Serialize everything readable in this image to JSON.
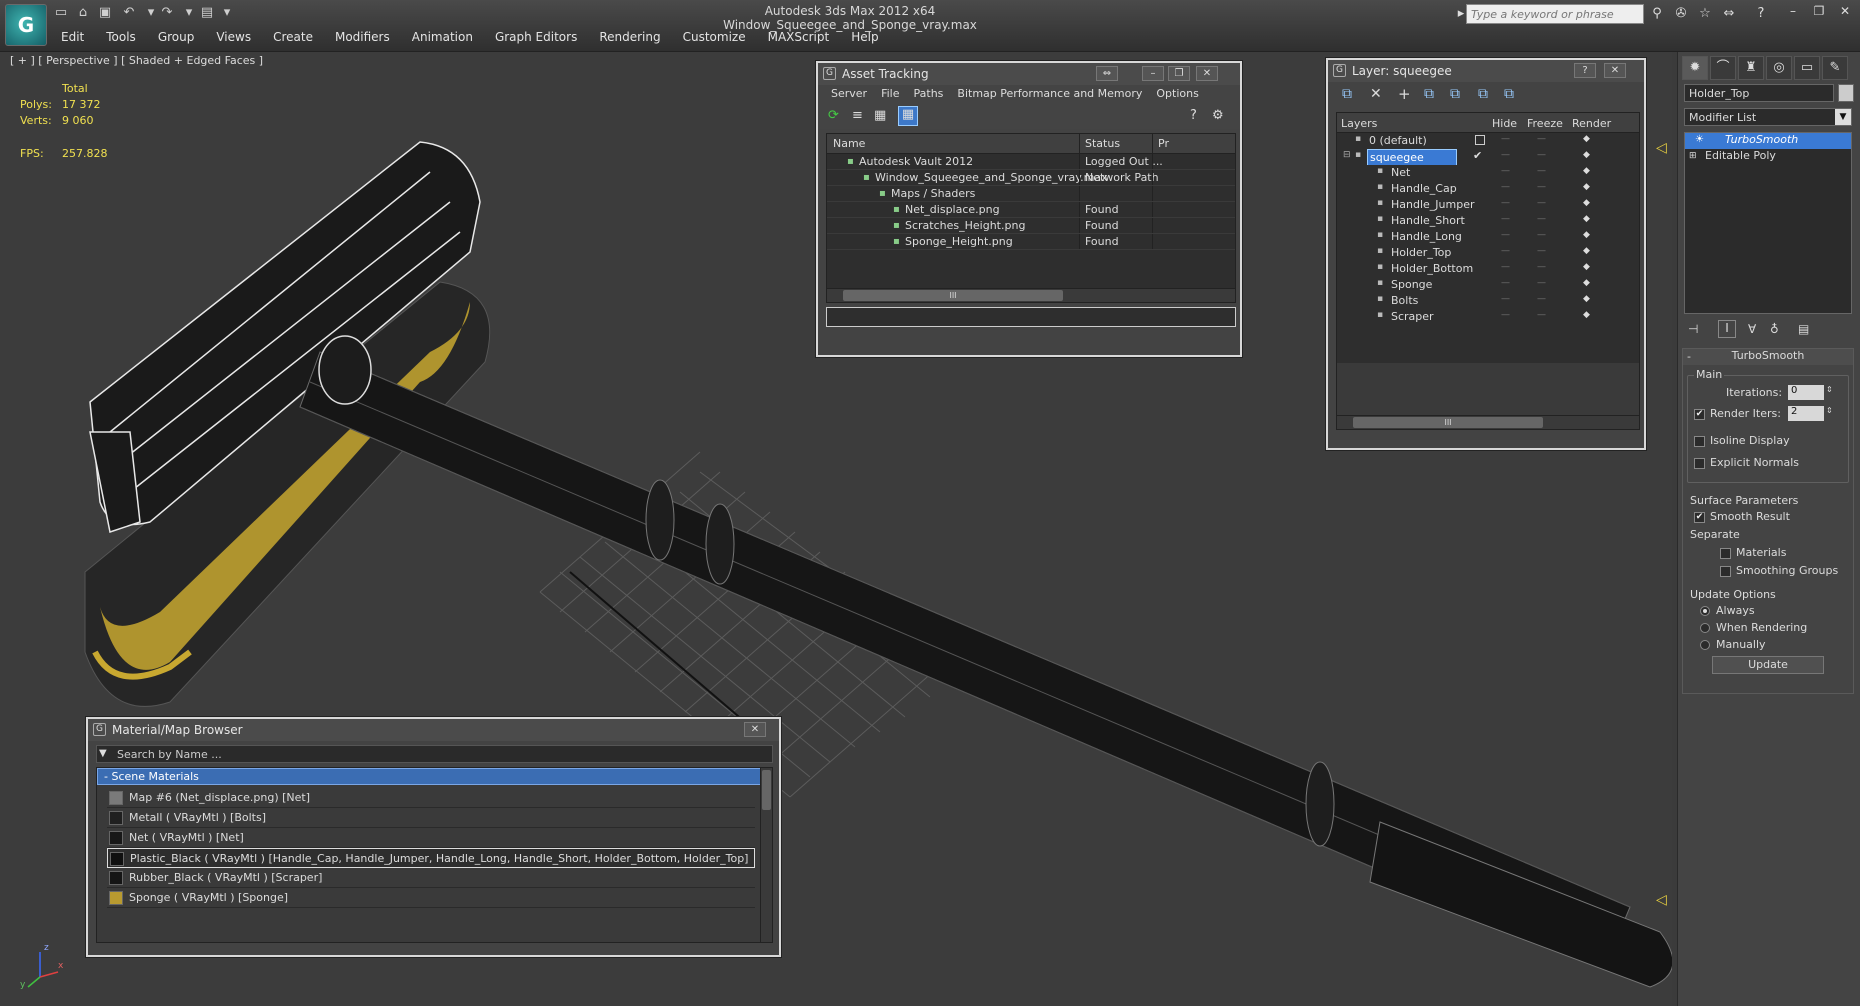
{
  "app": {
    "window_title": "Autodesk 3ds Max  2012 x64     Window_Squeegee_and_Sponge_vray.max",
    "logo": "3ds-max-logo",
    "search_placeholder": "Type a keyword or phrase"
  },
  "menus": [
    "Edit",
    "Tools",
    "Group",
    "Views",
    "Create",
    "Modifiers",
    "Animation",
    "Graph Editors",
    "Rendering",
    "Customize",
    "MAXScript",
    "Help"
  ],
  "viewport": {
    "label": "[ + ] [ Perspective ] [ Shaded + Edged Faces ]",
    "stats": {
      "total_label": "Total",
      "polys_label": "Polys:",
      "polys_value": "17 372",
      "verts_label": "Verts:",
      "verts_value": "9 060",
      "fps_label": "FPS:",
      "fps_value": "257.828"
    },
    "axis_x": "x",
    "axis_y": "y",
    "axis_z": "z"
  },
  "asset_tracking": {
    "title": "Asset Tracking",
    "menus": [
      "Server",
      "File",
      "Paths",
      "Bitmap Performance and Memory",
      "Options"
    ],
    "columns": [
      "Name",
      "Status",
      "Pr"
    ],
    "rows": [
      {
        "name": "Autodesk Vault 2012",
        "status": "Logged Out ...",
        "icon": "vault-icon"
      },
      {
        "name": "Window_Squeegee_and_Sponge_vray.max",
        "status": "Network Path",
        "icon": "max-file-icon"
      },
      {
        "name": "Maps / Shaders",
        "status": "",
        "icon": "maps-folder-icon"
      },
      {
        "name": "Net_displace.png",
        "status": "Found",
        "icon": "image-file-icon"
      },
      {
        "name": "Scratches_Height.png",
        "status": "Found",
        "icon": "image-file-icon"
      },
      {
        "name": "Sponge_Height.png",
        "status": "Found",
        "icon": "image-file-icon"
      }
    ],
    "scroll_grip": "III"
  },
  "layer_window": {
    "title": "Layer: squeegee",
    "help": "?",
    "columns": [
      "Layers",
      "Hide",
      "Freeze",
      "Render"
    ],
    "layers": [
      {
        "name": "0 (default)",
        "level": 0,
        "selected": false
      },
      {
        "name": "squeegee",
        "level": 0,
        "selected": true
      },
      {
        "name": "Net",
        "level": 1,
        "selected": false
      },
      {
        "name": "Handle_Cap",
        "level": 1,
        "selected": false
      },
      {
        "name": "Handle_Jumper",
        "level": 1,
        "selected": false
      },
      {
        "name": "Handle_Short",
        "level": 1,
        "selected": false
      },
      {
        "name": "Handle_Long",
        "level": 1,
        "selected": false
      },
      {
        "name": "Holder_Top",
        "level": 1,
        "selected": false
      },
      {
        "name": "Holder_Bottom",
        "level": 1,
        "selected": false
      },
      {
        "name": "Sponge",
        "level": 1,
        "selected": false
      },
      {
        "name": "Bolts",
        "level": 1,
        "selected": false
      },
      {
        "name": "Scraper",
        "level": 1,
        "selected": false
      }
    ],
    "scroll_grip": "III"
  },
  "material_browser": {
    "title": "Material/Map Browser",
    "search_placeholder": "Search by Name ...",
    "section": "- Scene Materials",
    "items": [
      {
        "label": "Map #6 (Net_displace.png)  [Net]",
        "swatch": "#7a7a7a"
      },
      {
        "label": "Metall  ( VRayMtl )  [Bolts]",
        "swatch": "#202020"
      },
      {
        "label": "Net  ( VRayMtl )  [Net]",
        "swatch": "#181818"
      },
      {
        "label": "Plastic_Black  ( VRayMtl )  [Handle_Cap, Handle_Jumper, Handle_Long, Handle_Short, Holder_Bottom, Holder_Top]",
        "swatch": "#101010",
        "selected": true
      },
      {
        "label": "Rubber_Black  ( VRayMtl )  [Scraper]",
        "swatch": "#151515"
      },
      {
        "label": "Sponge  ( VRayMtl )  [Sponge]",
        "swatch": "#b89a30"
      }
    ]
  },
  "command_panel": {
    "object_name": "Holder_Top",
    "modifier_list": "Modifier List",
    "stack": [
      "TurboSmooth",
      "Editable Poly"
    ],
    "rollout_title": "TurboSmooth",
    "main_label": "Main",
    "iterations_label": "Iterations:",
    "iterations_value": "0",
    "render_iters_label": "Render Iters:",
    "render_iters_value": "2",
    "render_iters_checked": true,
    "isoline_label": "Isoline Display",
    "explicit_normals_label": "Explicit Normals",
    "surface_params_label": "Surface Parameters",
    "smooth_result_label": "Smooth Result",
    "separate_label": "Separate",
    "materials_label": "Materials",
    "smoothing_groups_label": "Smoothing Groups",
    "update_options_label": "Update Options",
    "always_label": "Always",
    "when_rendering_label": "When Rendering",
    "manually_label": "Manually",
    "update_button": "Update",
    "collapse": "-"
  }
}
